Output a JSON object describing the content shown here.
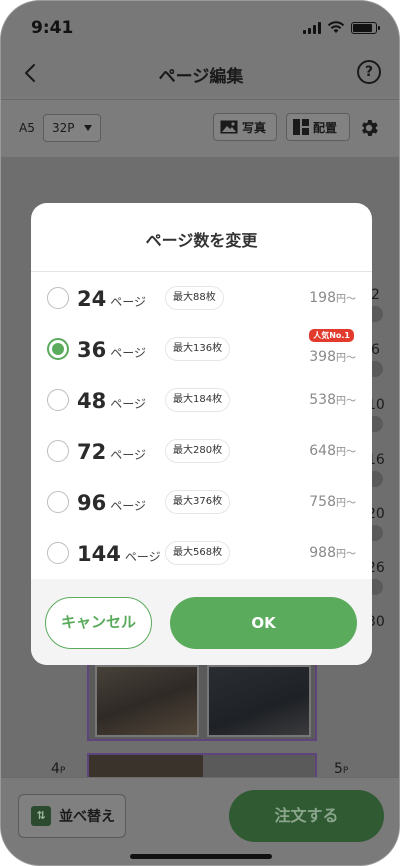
{
  "status_bar": {
    "time": "9:41"
  },
  "nav": {
    "title": "ページ編集",
    "help_label": "?"
  },
  "toolbar": {
    "size_label": "A5",
    "page_select_value": "32P",
    "photo_label": "写真",
    "layout_label": "配置"
  },
  "side_labels": [
    "2",
    "6",
    "10",
    "16",
    "20",
    "26",
    "30"
  ],
  "page_labels": {
    "left": "4",
    "right": "5",
    "unit": "P"
  },
  "bottom": {
    "sort_label": "並べ替え",
    "order_label": "注文する"
  },
  "modal": {
    "title": "ページ数を変更",
    "options": [
      {
        "pages": "24",
        "unit": "ページ",
        "max": "最大88枚",
        "price": "198",
        "price_unit": "円〜",
        "selected": false
      },
      {
        "pages": "36",
        "unit": "ページ",
        "max": "最大136枚",
        "price": "398",
        "price_unit": "円〜",
        "selected": true,
        "badge": "人気No.1"
      },
      {
        "pages": "48",
        "unit": "ページ",
        "max": "最大184枚",
        "price": "538",
        "price_unit": "円〜",
        "selected": false
      },
      {
        "pages": "72",
        "unit": "ページ",
        "max": "最大280枚",
        "price": "648",
        "price_unit": "円〜",
        "selected": false
      },
      {
        "pages": "96",
        "unit": "ページ",
        "max": "最大376枚",
        "price": "758",
        "price_unit": "円〜",
        "selected": false
      },
      {
        "pages": "144",
        "unit": "ページ",
        "max": "最大568枚",
        "price": "988",
        "price_unit": "円〜",
        "selected": false
      }
    ],
    "cancel_label": "キャンセル",
    "ok_label": "OK"
  },
  "colors": {
    "accent": "#5bab5d",
    "badge": "#e23a2c"
  }
}
